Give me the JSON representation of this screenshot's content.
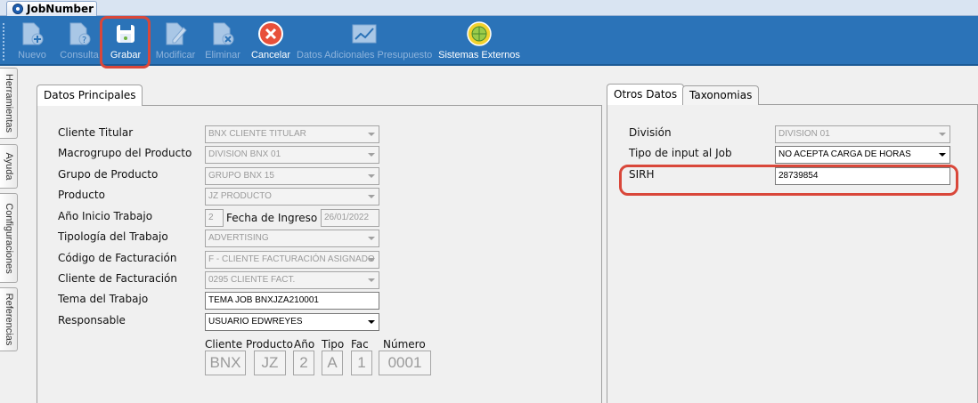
{
  "window": {
    "tab_title": "JobNumber"
  },
  "toolbar": {
    "buttons": [
      {
        "label": "Nuevo",
        "icon": "new-document-icon",
        "enabled": false
      },
      {
        "label": "Consulta",
        "icon": "query-document-icon",
        "enabled": false
      },
      {
        "label": "Grabar",
        "icon": "save-disk-icon",
        "enabled": true
      },
      {
        "label": "Modificar",
        "icon": "edit-document-icon",
        "enabled": false
      },
      {
        "label": "Eliminar",
        "icon": "delete-document-icon",
        "enabled": false
      },
      {
        "label": "Cancelar",
        "icon": "cancel-icon",
        "enabled": true
      },
      {
        "label": "Datos Adicionales Presupuesto",
        "icon": "trend-chart-icon",
        "enabled": false
      },
      {
        "label": "Sistemas Externos",
        "icon": "globe-icon",
        "enabled": true
      }
    ],
    "highlight_color": "#d9473a"
  },
  "side_tabs": [
    "Herramientas",
    "Ayuda",
    "Configuraciones",
    "Referencias"
  ],
  "left_panel": {
    "tab": "Datos Principales",
    "fields": {
      "cliente_titular": {
        "label": "Cliente Titular",
        "value": "BNX CLIENTE TITULAR"
      },
      "macrogrupo": {
        "label": "Macrogrupo del Producto",
        "value": "DIVISION BNX 01"
      },
      "grupo": {
        "label": "Grupo de Producto",
        "value": "GRUPO BNX 15"
      },
      "producto": {
        "label": "Producto",
        "value": "JZ PRODUCTO"
      },
      "anio_inicio": {
        "label": "Año Inicio Trabajo",
        "value": "2"
      },
      "fecha_ingreso": {
        "label": "Fecha de Ingreso",
        "value": "26/01/2022"
      },
      "tipologia": {
        "label": "Tipología del Trabajo",
        "value": "ADVERTISING"
      },
      "codigo_fact": {
        "label": "Código de Facturación",
        "value": "F - CLIENTE FACTURACIÓN ASIGNADO"
      },
      "cliente_fact": {
        "label": "Cliente de Facturación",
        "value": "0295 CLIENTE FACT."
      },
      "tema": {
        "label": "Tema del Trabajo",
        "value": "TEMA JOB BNXJZA210001"
      },
      "responsable": {
        "label": "Responsable",
        "value": "USUARIO EDWREYES"
      }
    },
    "code": {
      "cliente": {
        "label": "Cliente",
        "value": "BNX"
      },
      "producto": {
        "label": "Producto",
        "value": "JZ"
      },
      "anio": {
        "label": "Año",
        "value": "2"
      },
      "tipo": {
        "label": "Tipo",
        "value": "A"
      },
      "fac": {
        "label": "Fac",
        "value": "1"
      },
      "numero": {
        "label": "Número",
        "value": "0001"
      }
    }
  },
  "right_panel": {
    "tabs": [
      "Otros Datos",
      "Taxonomias"
    ],
    "fields": {
      "division": {
        "label": "División",
        "value": "DIVISION 01"
      },
      "tipo_input": {
        "label": "Tipo de input al Job",
        "value": "NO ACEPTA CARGA DE HORAS"
      },
      "sirh": {
        "label": "SIRH",
        "value": "28739854"
      }
    }
  }
}
